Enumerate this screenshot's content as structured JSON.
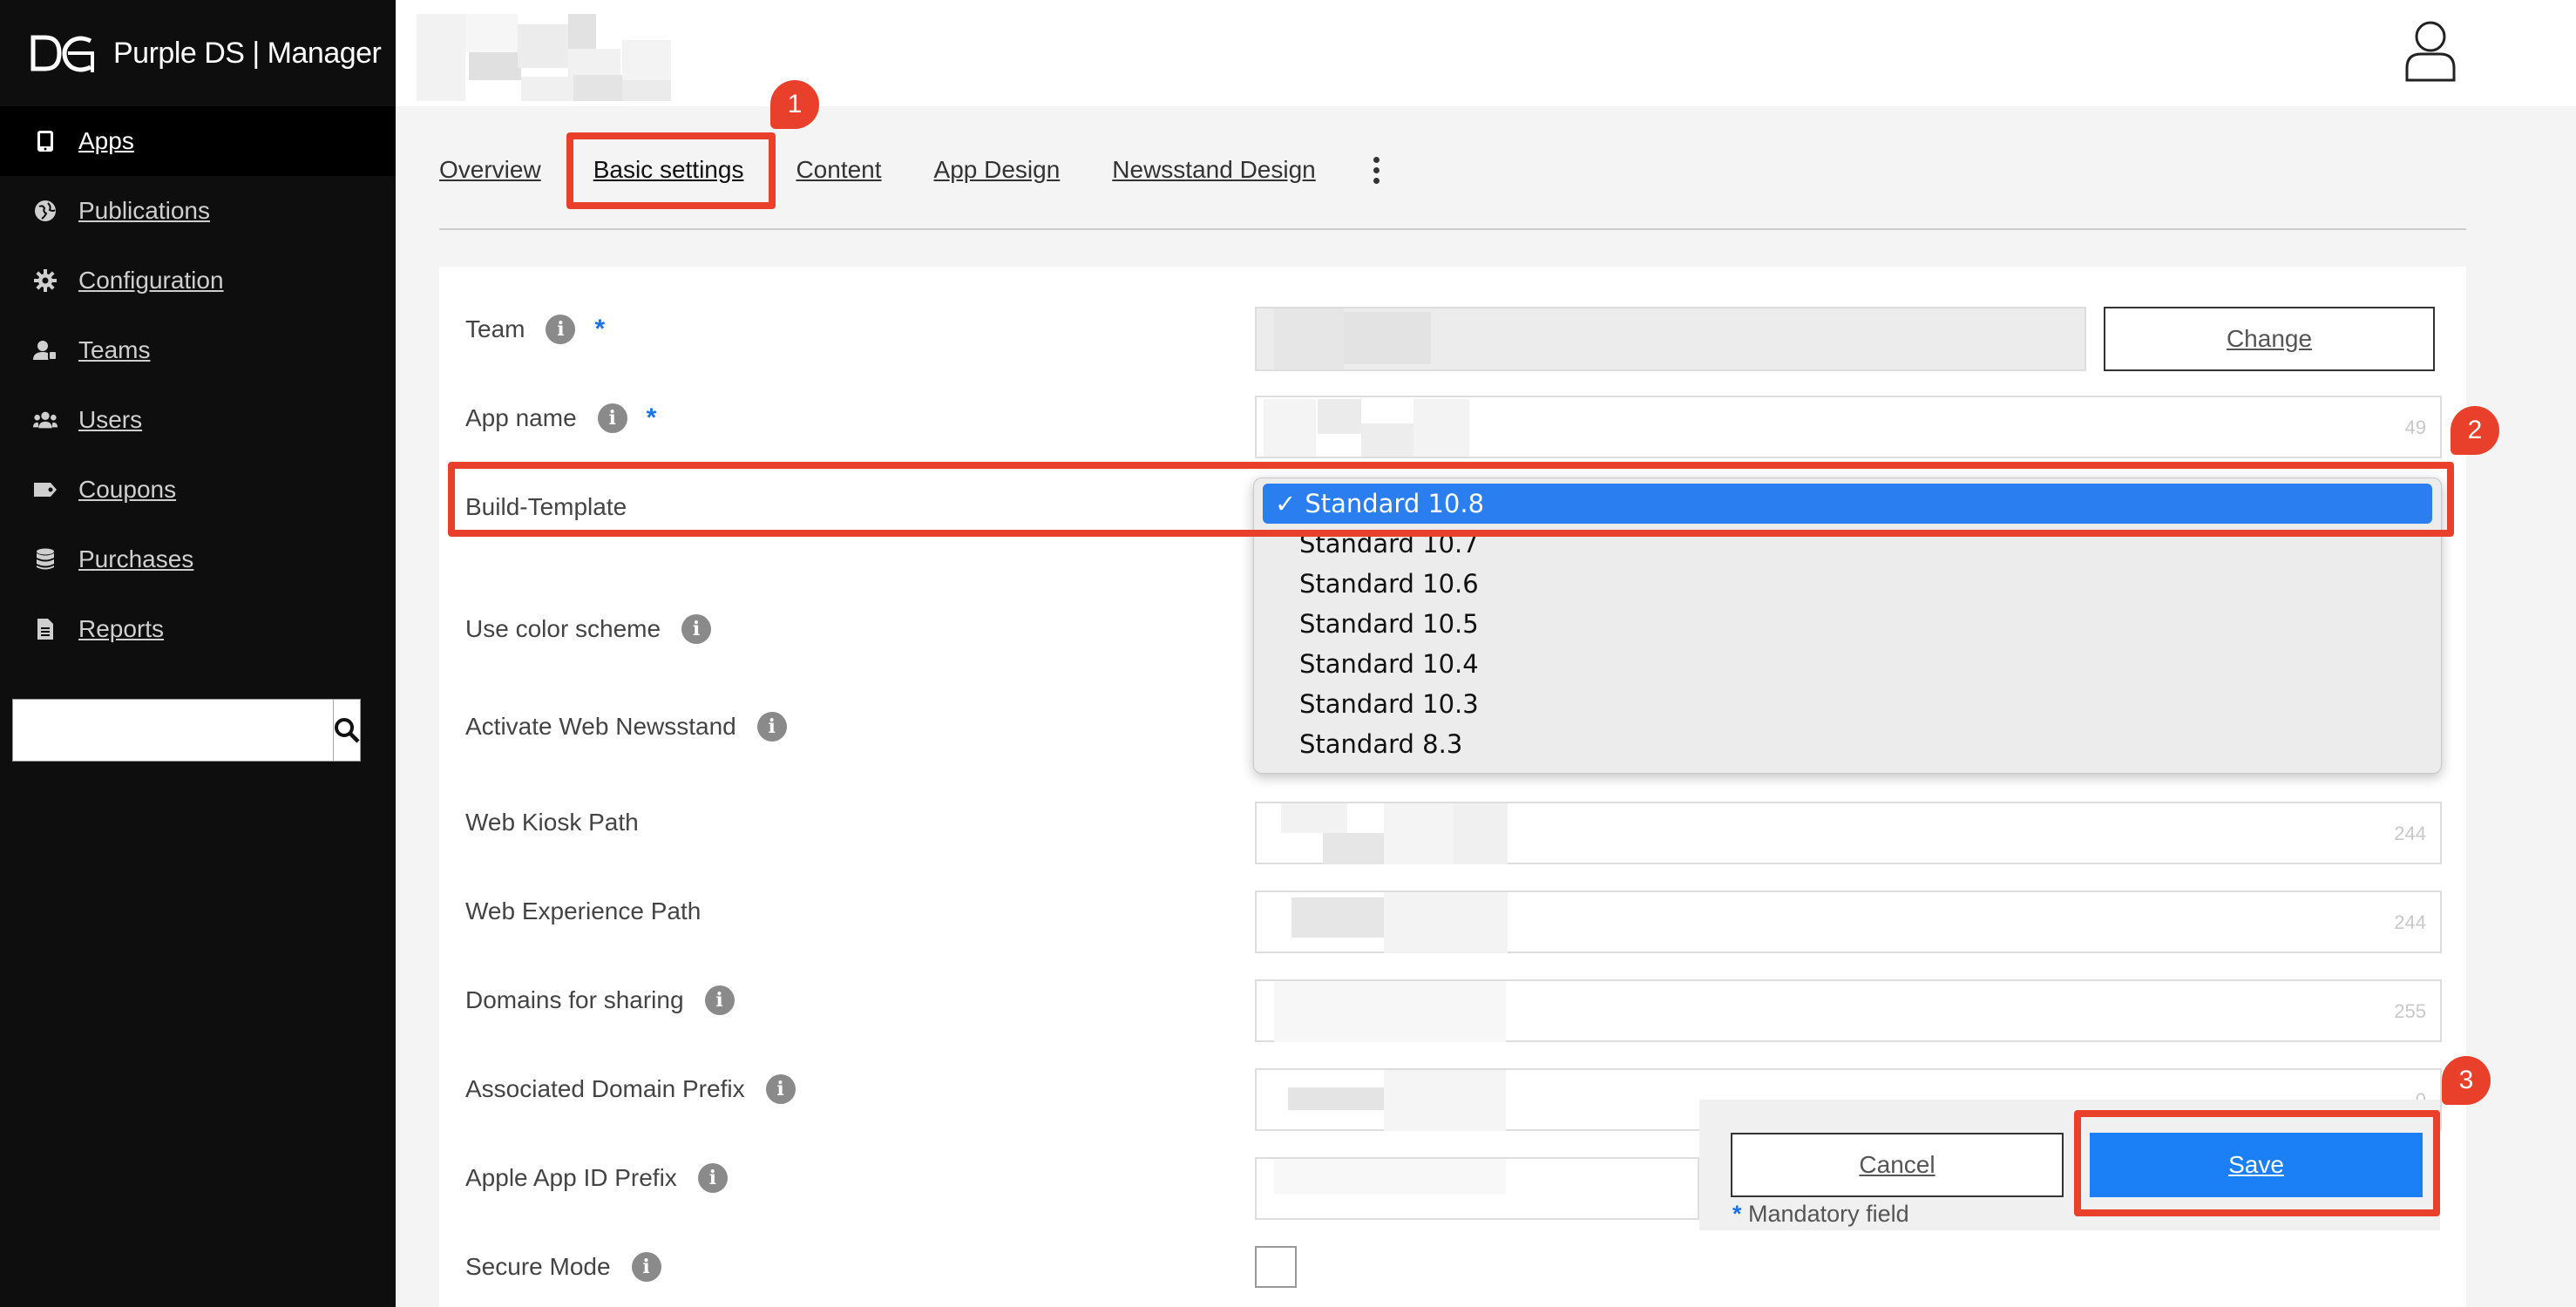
{
  "app": {
    "logo_text": "Purple DS | Manager"
  },
  "sidebar": {
    "items": [
      {
        "label": "Apps",
        "icon": "tablet-icon",
        "active": true
      },
      {
        "label": "Publications",
        "icon": "globe-icon"
      },
      {
        "label": "Configuration",
        "icon": "gear-icon"
      },
      {
        "label": "Teams",
        "icon": "team-icon"
      },
      {
        "label": "Users",
        "icon": "users-icon"
      },
      {
        "label": "Coupons",
        "icon": "coupon-icon"
      },
      {
        "label": "Purchases",
        "icon": "database-icon"
      },
      {
        "label": "Reports",
        "icon": "document-icon"
      }
    ],
    "search": {
      "placeholder": "",
      "value": ""
    }
  },
  "tabs": [
    {
      "label": "Overview"
    },
    {
      "label": "Basic settings",
      "active": true
    },
    {
      "label": "Content"
    },
    {
      "label": "App Design"
    },
    {
      "label": "Newsstand Design"
    }
  ],
  "form": {
    "team": {
      "label": "Team",
      "required_mark": "*",
      "change_label": "Change"
    },
    "app_name": {
      "label": "App name",
      "required_mark": "*",
      "counter": "49"
    },
    "build_template": {
      "label": "Build-Template",
      "selected": "Standard 10.8",
      "options": [
        "Standard 10.8",
        "Standard 10.7",
        "Standard 10.6",
        "Standard 10.5",
        "Standard 10.4",
        "Standard 10.3",
        "Standard 8.3"
      ]
    },
    "use_color_scheme": {
      "label": "Use color scheme"
    },
    "activate_web_newsstand": {
      "label": "Activate Web Newsstand"
    },
    "web_kiosk_path": {
      "label": "Web Kiosk Path",
      "counter": "244"
    },
    "web_experience_path": {
      "label": "Web Experience Path",
      "counter": "244"
    },
    "domains_for_sharing": {
      "label": "Domains for sharing",
      "counter": "255"
    },
    "associated_domain_prefix": {
      "label": "Associated Domain Prefix",
      "counter": "0"
    },
    "apple_app_id_prefix": {
      "label": "Apple App ID Prefix"
    },
    "secure_mode": {
      "label": "Secure Mode"
    }
  },
  "footer": {
    "cancel_label": "Cancel",
    "save_label": "Save",
    "mandatory_star": "*",
    "mandatory_text": "Mandatory field"
  },
  "annotations": [
    "1",
    "2",
    "3"
  ],
  "colors": {
    "accent": "#1b7ff5",
    "highlight": "#e8402b",
    "sidebar_bg": "#0e0e0e",
    "selected_option": "#2a7ef0"
  }
}
